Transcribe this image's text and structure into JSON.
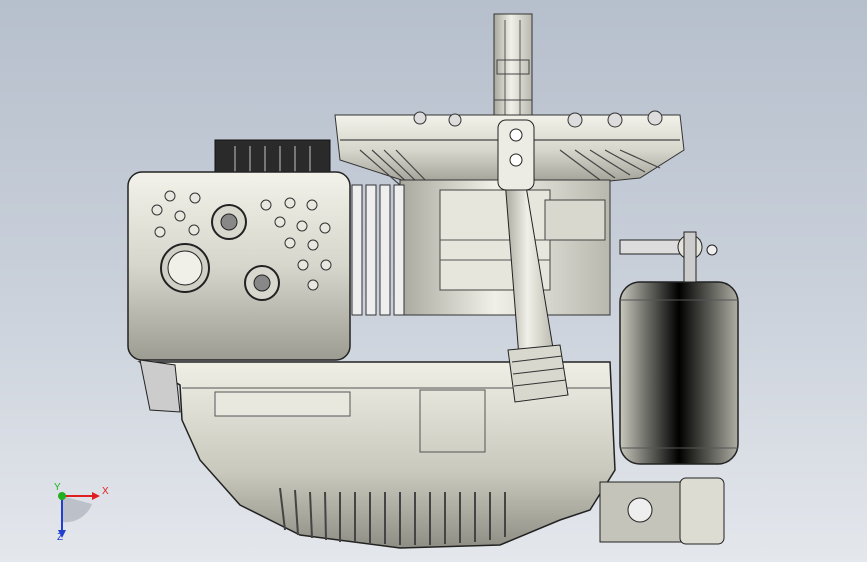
{
  "viewport": {
    "background_top": "#b6bfcc",
    "background_bottom": "#e4e7ec",
    "model_name": "",
    "model_icon": "engine-assembly-icon"
  },
  "triad": {
    "x_label": "X",
    "y_label": "Y",
    "z_label": "Z",
    "x_color": "#e02020",
    "y_color": "#20b020",
    "z_color": "#2040d0"
  }
}
